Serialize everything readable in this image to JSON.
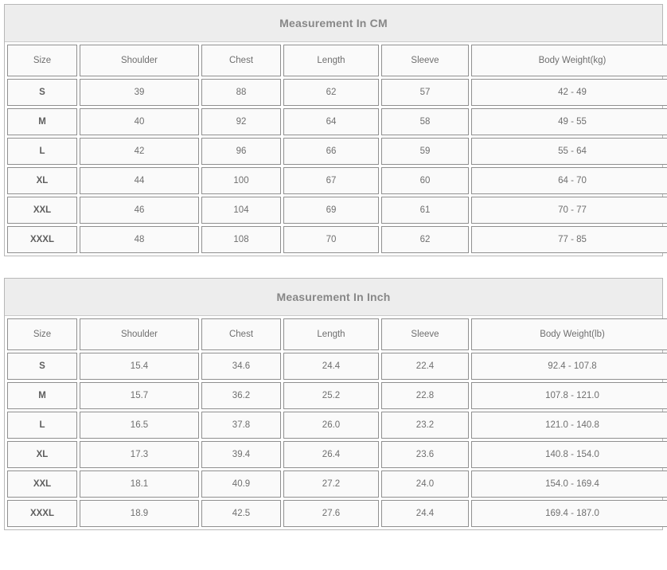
{
  "tables": [
    {
      "id": "cm",
      "title": "Measurement In CM",
      "columns": [
        "Size",
        "Shoulder",
        "Chest",
        "Length",
        "Sleeve",
        "Body Weight(kg)"
      ],
      "rows": [
        [
          "S",
          "39",
          "88",
          "62",
          "57",
          "42 - 49"
        ],
        [
          "M",
          "40",
          "92",
          "64",
          "58",
          "49 - 55"
        ],
        [
          "L",
          "42",
          "96",
          "66",
          "59",
          "55 - 64"
        ],
        [
          "XL",
          "44",
          "100",
          "67",
          "60",
          "64 - 70"
        ],
        [
          "XXL",
          "46",
          "104",
          "69",
          "61",
          "70 - 77"
        ],
        [
          "XXXL",
          "48",
          "108",
          "70",
          "62",
          "77 - 85"
        ]
      ]
    },
    {
      "id": "inch",
      "title": "Measurement In Inch",
      "columns": [
        "Size",
        "Shoulder",
        "Chest",
        "Length",
        "Sleeve",
        "Body Weight(lb)"
      ],
      "rows": [
        [
          "S",
          "15.4",
          "34.6",
          "24.4",
          "22.4",
          "92.4 - 107.8"
        ],
        [
          "M",
          "15.7",
          "36.2",
          "25.2",
          "22.8",
          "107.8 - 121.0"
        ],
        [
          "L",
          "16.5",
          "37.8",
          "26.0",
          "23.2",
          "121.0 - 140.8"
        ],
        [
          "XL",
          "17.3",
          "39.4",
          "26.4",
          "23.6",
          "140.8 - 154.0"
        ],
        [
          "XXL",
          "18.1",
          "40.9",
          "27.2",
          "24.0",
          "154.0 - 169.4"
        ],
        [
          "XXXL",
          "18.9",
          "42.5",
          "27.6",
          "24.4",
          "169.4 - 187.0"
        ]
      ]
    }
  ],
  "colors": {
    "title_bg": "#ededed",
    "title_text": "#878787",
    "cell_bg": "#fafafa",
    "cell_text": "#6f6f6f",
    "cell_border": "#8f8f8f",
    "table_border": "#b8b8b8"
  }
}
